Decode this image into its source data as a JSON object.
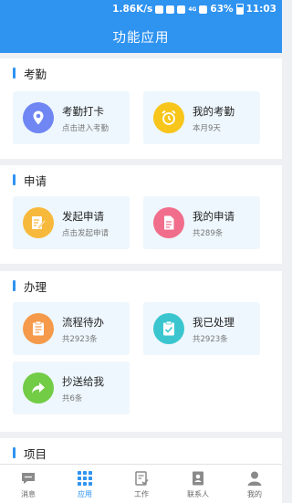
{
  "status_bar": {
    "speed": "1.86K/s",
    "network": "4G",
    "battery": "63%",
    "time": "11:03"
  },
  "header": {
    "title": "功能应用"
  },
  "sections": [
    {
      "title": "考勤",
      "items": [
        {
          "label": "考勤打卡",
          "sub": "点击进入考勤",
          "icon": "location-pin-icon",
          "color": "#6f86f3"
        },
        {
          "label": "我的考勤",
          "sub": "本月9天",
          "icon": "alarm-clock-icon",
          "color": "#f8c51b"
        }
      ]
    },
    {
      "title": "申请",
      "items": [
        {
          "label": "发起申请",
          "sub": "点击发起申请",
          "icon": "edit-document-icon",
          "color": "#f7b93c"
        },
        {
          "label": "我的申请",
          "sub": "共289条",
          "icon": "document-icon",
          "color": "#f06e8c"
        }
      ]
    },
    {
      "title": "办理",
      "items": [
        {
          "label": "流程待办",
          "sub": "共2923条",
          "icon": "clipboard-list-icon",
          "color": "#f59a4a"
        },
        {
          "label": "我已处理",
          "sub": "共2923条",
          "icon": "clipboard-check-icon",
          "color": "#3bc6cf"
        },
        {
          "label": "抄送给我",
          "sub": "共6条",
          "icon": "forward-arrow-icon",
          "color": "#72cc46"
        }
      ]
    },
    {
      "title": "项目",
      "items": []
    }
  ],
  "tabbar": {
    "active_index": 1,
    "items": [
      {
        "label": "消息",
        "icon": "message-icon"
      },
      {
        "label": "应用",
        "icon": "apps-grid-icon"
      },
      {
        "label": "工作",
        "icon": "work-checklist-icon"
      },
      {
        "label": "联系人",
        "icon": "contacts-icon"
      },
      {
        "label": "我的",
        "icon": "profile-icon"
      }
    ]
  },
  "colors": {
    "accent": "#2f93f0",
    "card_bg": "#eef7fd",
    "page_bg": "#eef0f3"
  }
}
